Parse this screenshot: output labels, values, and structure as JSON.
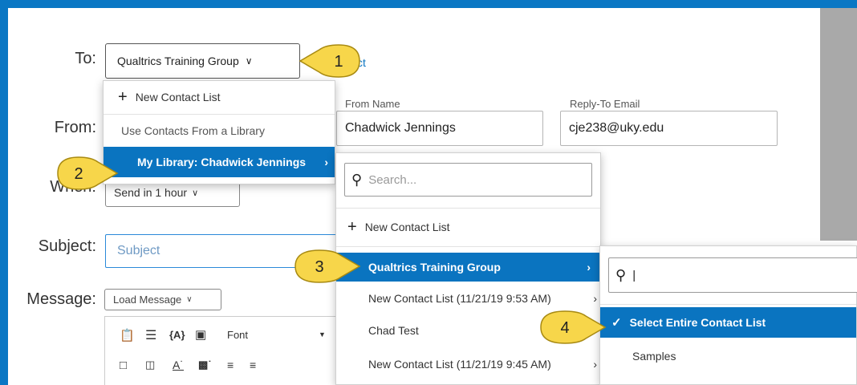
{
  "labels": {
    "to": "To:",
    "from": "From:",
    "when": "When:",
    "subject": "Subject:",
    "message": "Message:"
  },
  "to_dropdown": {
    "value": "Qualtrics Training Group",
    "chevron": "⌄"
  },
  "select_link": "ct",
  "from_name": {
    "label": "From Name",
    "value": "Chadwick Jennings"
  },
  "reply_to": {
    "label": "Reply-To Email",
    "value": "cje238@uky.edu"
  },
  "when_dropdown": {
    "value": "Send in 1 hour"
  },
  "subject_field": {
    "placeholder": "Subject"
  },
  "load_message": {
    "label": "Load Message"
  },
  "editor_toolbar": {
    "font_label": "Font"
  },
  "menu1": {
    "new_contact_list": "New Contact List",
    "section_header": "Use Contacts From a Library",
    "library_item": "My Library: Chadwick Jennings"
  },
  "menu2": {
    "search_placeholder": "Search...",
    "new_contact_list": "New Contact List",
    "items": [
      "Qualtrics Training Group",
      "New Contact List (11/21/19 9:53 AM)",
      "Chad Test",
      "New Contact List (11/21/19 9:45 AM)"
    ]
  },
  "menu3": {
    "search_value": "|",
    "select_entire": "Select Entire Contact List",
    "samples": "Samples"
  },
  "callouts": [
    "1",
    "2",
    "3",
    "4"
  ],
  "colors": {
    "frame_border": "#0a77c4",
    "selection": "#0a74c0",
    "callout_fill": "#f7d64a",
    "callout_border": "#a88a12"
  }
}
